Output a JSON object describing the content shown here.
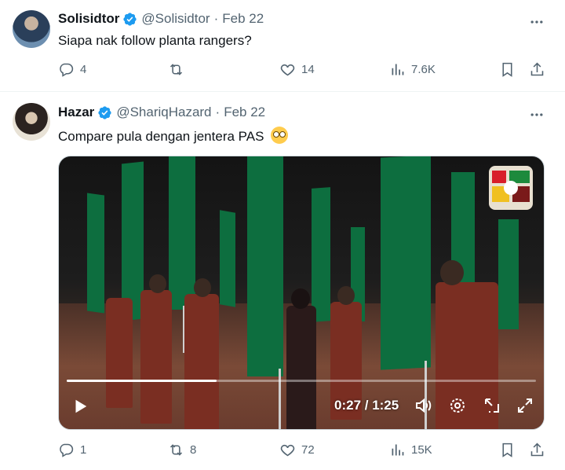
{
  "tweets": [
    {
      "name": "Solisidtor",
      "handle": "@Solisidtor",
      "date": "Feb 22",
      "text": "Siapa nak follow planta rangers?",
      "replies": "4",
      "retweets": "",
      "likes": "14",
      "views": "7.6K"
    },
    {
      "name": "Hazar",
      "handle": "@ShariqHazard",
      "date": "Feb 22",
      "text": "Compare pula dengan jentera PAS",
      "replies": "1",
      "retweets": "8",
      "likes": "72",
      "views": "15K",
      "video": {
        "time": "0:27 / 1:25",
        "progress": 0.32
      }
    }
  ],
  "separator": "·",
  "icons": {
    "verified": "verified-badge-icon",
    "more": "more-icon",
    "reply": "reply-icon",
    "retweet": "retweet-icon",
    "like": "heart-icon",
    "views": "views-icon",
    "bookmark": "bookmark-icon",
    "share": "share-icon",
    "emoji": "flushed-face-emoji",
    "play": "play-icon",
    "volume": "volume-icon",
    "settings": "gear-icon",
    "popout": "popout-icon",
    "fullscreen": "fullscreen-icon"
  },
  "colors": {
    "verified": "#1d9bf0",
    "muted": "#536471",
    "text": "#0f1419",
    "flag_green": "#0d6e3f"
  }
}
